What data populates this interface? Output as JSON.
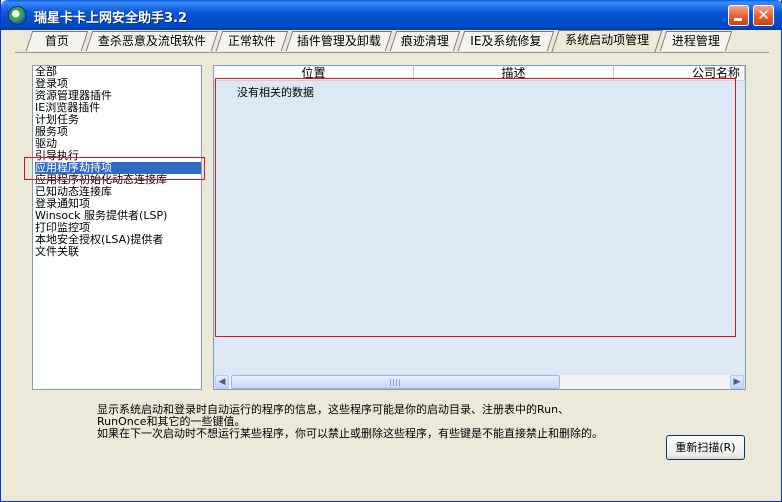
{
  "window": {
    "title": "瑞星卡卡上网安全助手3.2"
  },
  "tabs": [
    {
      "label": "首页"
    },
    {
      "label": "查杀恶意及流氓软件"
    },
    {
      "label": "正常软件"
    },
    {
      "label": "插件管理及卸载"
    },
    {
      "label": "痕迹清理"
    },
    {
      "label": "IE及系统修复"
    },
    {
      "label": "系统启动项管理",
      "active": true
    },
    {
      "label": "进程管理"
    }
  ],
  "tree": {
    "items": [
      {
        "label": "全部"
      },
      {
        "label": "登录项"
      },
      {
        "label": "资源管理器插件"
      },
      {
        "label": "IE浏览器插件"
      },
      {
        "label": "计划任务"
      },
      {
        "label": "服务项"
      },
      {
        "label": "驱动"
      },
      {
        "label": "引导执行"
      },
      {
        "label": "应用程序劫持项",
        "selected": true
      },
      {
        "label": "应用程序初始化动态连接库"
      },
      {
        "label": "已知动态连接库"
      },
      {
        "label": "登录通知项"
      },
      {
        "label": "Winsock 服务提供者(LSP)"
      },
      {
        "label": "打印监控项"
      },
      {
        "label": "本地安全授权(LSA)提供者"
      },
      {
        "label": "文件关联"
      }
    ]
  },
  "listview": {
    "columns": [
      {
        "label": "位置"
      },
      {
        "label": "描述"
      },
      {
        "label": "公司名称"
      }
    ],
    "empty_text": "没有相关的数据"
  },
  "description": {
    "line1": "显示系统启动和登录时自动运行的程序的信息，这些程序可能是你的启动目录、注册表中的Run、RunOnce和其它的一些键值。",
    "line2": "如果在下一次启动时不想运行某些程序，你可以禁止或删除这些程序，有些键是不能直接禁止和删除的。"
  },
  "buttons": {
    "rescan": "重新扫描(R)"
  },
  "icons": {
    "app": "app-logo-icon",
    "minimize": "minimize-icon",
    "close": "close-icon",
    "scroll_left": "chevron-left-icon",
    "scroll_right": "chevron-right-icon"
  }
}
